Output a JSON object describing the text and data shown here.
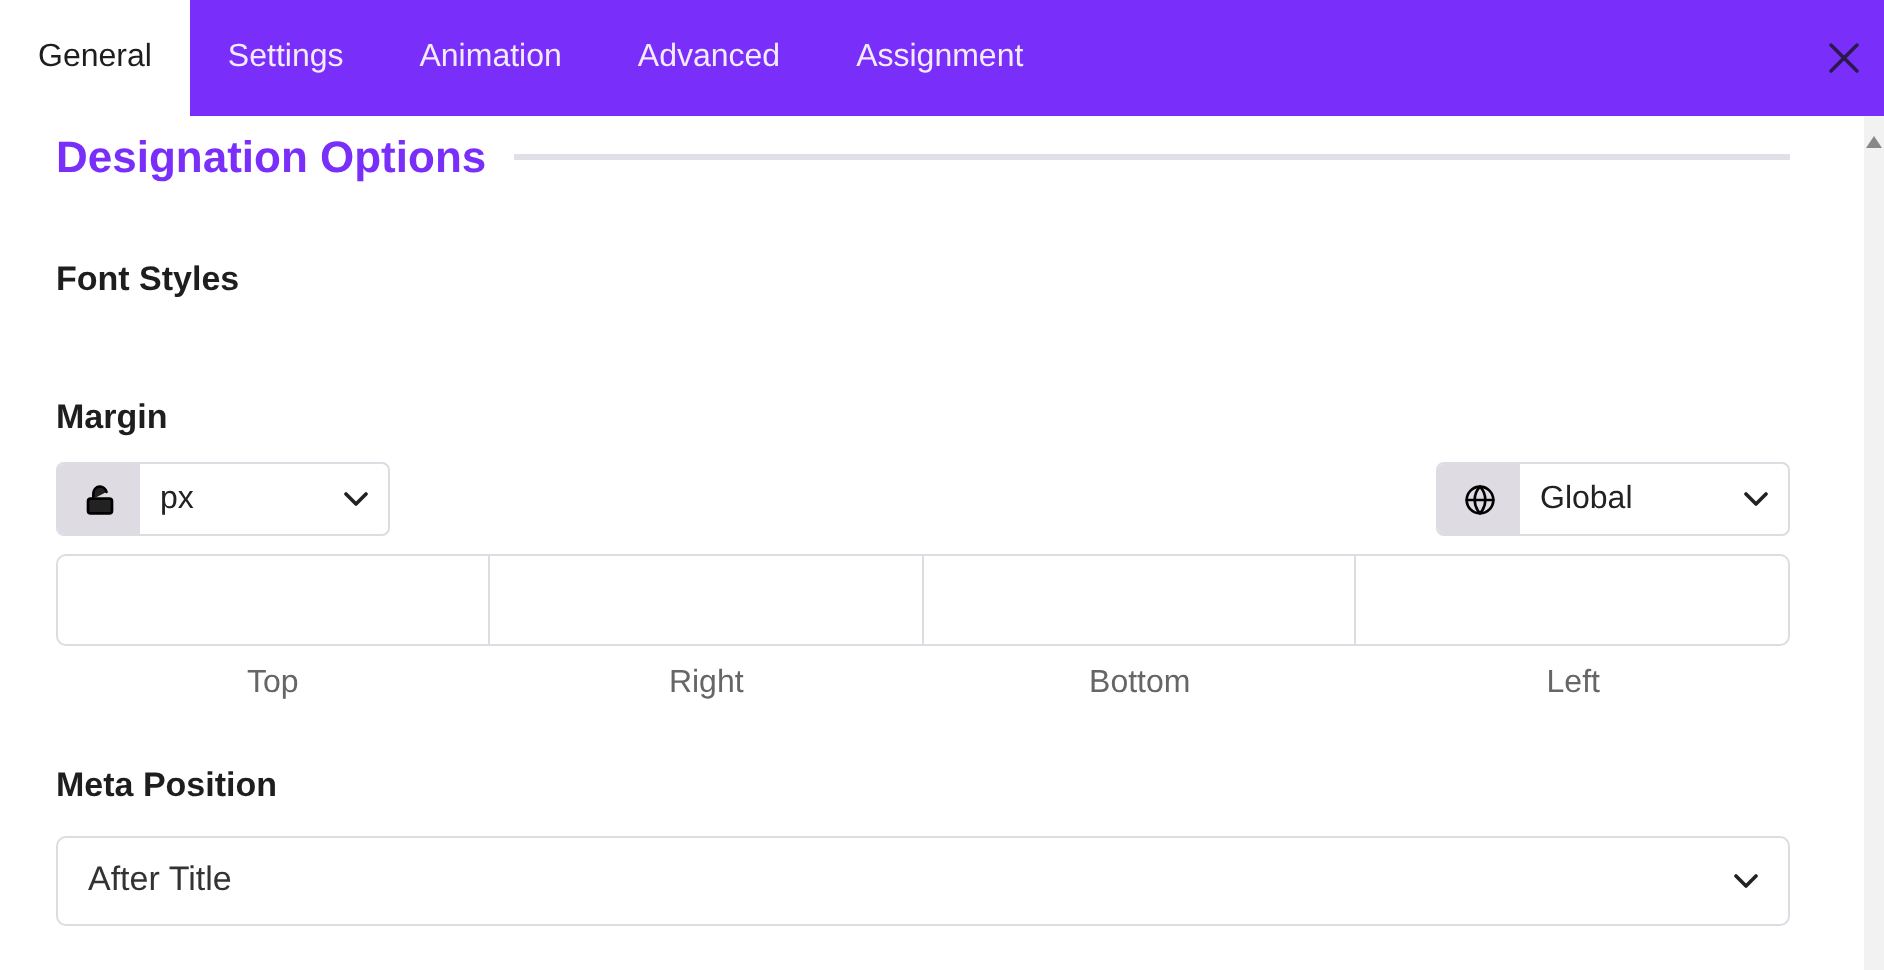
{
  "tabs": [
    {
      "label": "General",
      "selected": true
    },
    {
      "label": "Settings",
      "selected": false
    },
    {
      "label": "Animation",
      "selected": false
    },
    {
      "label": "Advanced",
      "selected": false
    },
    {
      "label": "Assignment",
      "selected": false
    }
  ],
  "section_title": "Designation Options",
  "font_styles": {
    "label": "Font Styles"
  },
  "margin": {
    "label": "Margin",
    "unit": "px",
    "locked": false,
    "scope": "Global",
    "sides": [
      {
        "label": "Top"
      },
      {
        "label": "Right"
      },
      {
        "label": "Bottom"
      },
      {
        "label": "Left"
      }
    ]
  },
  "meta_position": {
    "label": "Meta Position",
    "value": "After Title"
  }
}
